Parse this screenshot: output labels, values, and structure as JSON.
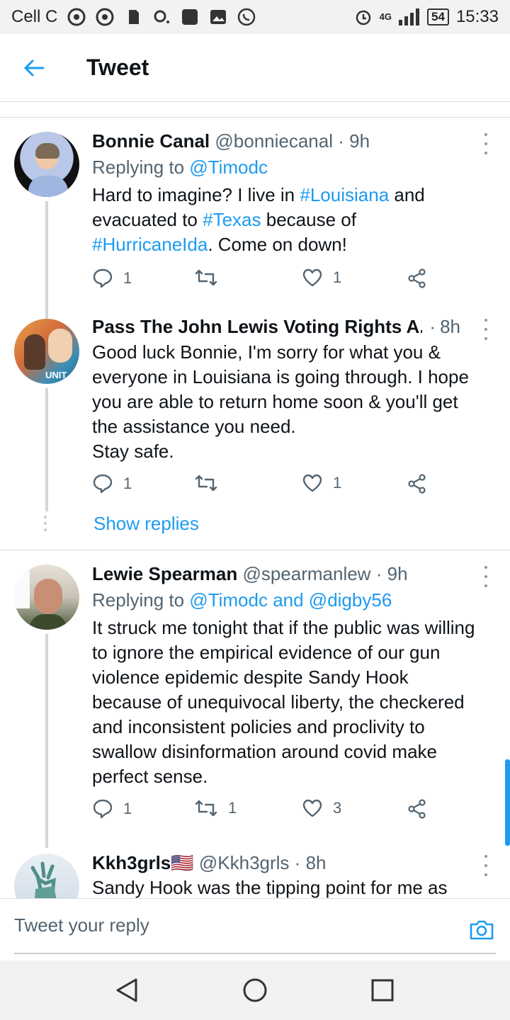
{
  "status_bar": {
    "carrier": "Cell C",
    "network": "4G",
    "battery": "54",
    "time": "15:33"
  },
  "header": {
    "title": "Tweet"
  },
  "tweets": [
    {
      "name": "Bonnie Canal",
      "handle": "@bonniecanal",
      "time": "9h",
      "replying_prefix": "Replying to",
      "replying_to": "@Timodc",
      "text_parts": [
        {
          "t": "Hard to imagine? I live in ",
          "h": false
        },
        {
          "t": "#Louisiana",
          "h": true
        },
        {
          "t": " and evacuated to ",
          "h": false
        },
        {
          "t": "#Texas",
          "h": true
        },
        {
          "t": " because of ",
          "h": false
        },
        {
          "t": "#HurricaneIda",
          "h": true
        },
        {
          "t": ". Come on down!",
          "h": false
        }
      ],
      "replies": "1",
      "retweets": "",
      "likes": "1"
    },
    {
      "name": "Pass The John Lewis Voting Rights A...",
      "time": "8h",
      "avatar_text": "UNIT",
      "text": "Good luck Bonnie, I'm sorry for what you & everyone in Louisiana is going through. I hope you are able to return home soon & you'll get the assistance you need.\nStay safe.",
      "replies": "1",
      "retweets": "",
      "likes": "1"
    },
    {
      "name": "Lewie Spearman",
      "handle": "@spearmanlew",
      "time": "9h",
      "replying_prefix": "Replying to",
      "replying_to": "@Timodc and @digby56",
      "text": "It struck me tonight that if the public was willing to ignore the empirical evidence of our gun violence epidemic despite Sandy Hook because of unequivocal liberty, the checkered and inconsistent policies and proclivity to swallow disinformation around covid make perfect sense.",
      "replies": "1",
      "retweets": "1",
      "likes": "3"
    },
    {
      "name": "Kkh3grls🇺🇸",
      "handle": "@Kkh3grls",
      "time": "8h",
      "text": "Sandy Hook was the tipping point for me as"
    }
  ],
  "show_replies": "Show replies",
  "reply_bar": {
    "placeholder": "Tweet your reply"
  },
  "icons": {
    "back": "arrow-left-icon",
    "reply": "speech-bubble-icon",
    "retweet": "retweet-icon",
    "like": "heart-icon",
    "share": "share-icon",
    "more": "more-vertical-icon",
    "camera": "camera-icon"
  },
  "colors": {
    "accent": "#1d9bf0",
    "secondary_text": "#536471"
  }
}
